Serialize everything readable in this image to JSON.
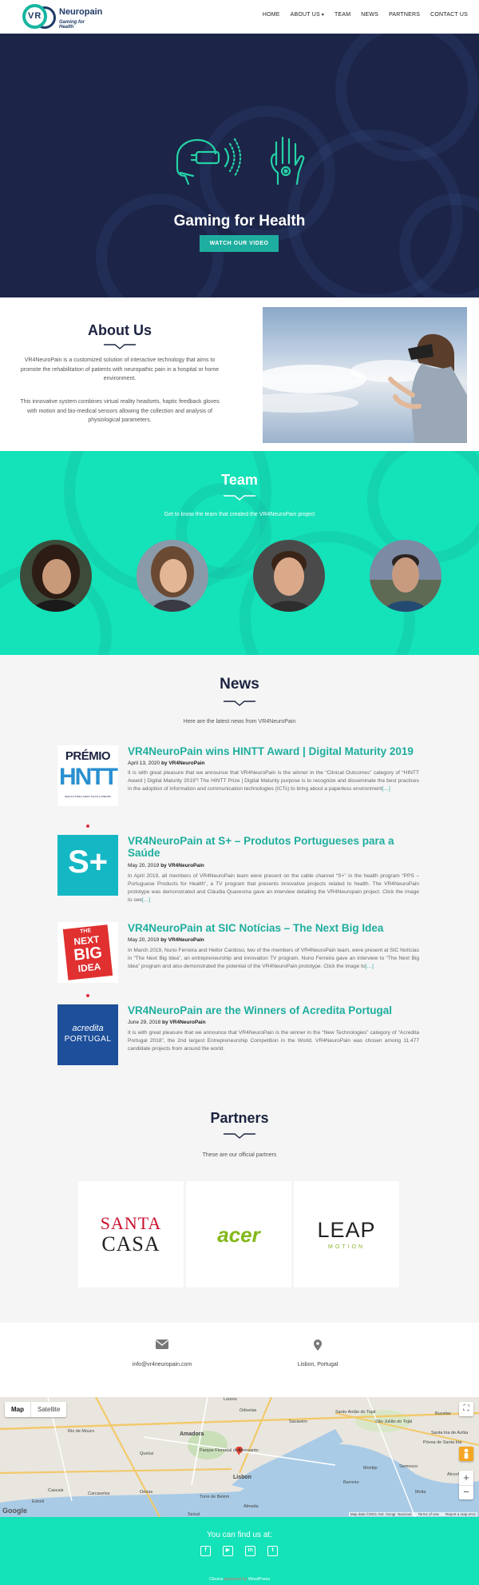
{
  "nav": {
    "logo_text": "VR",
    "brand_name": "Neuropain",
    "brand_tagline": "Gaming for Health",
    "items": [
      {
        "label": "HOME"
      },
      {
        "label": "ABOUT US"
      },
      {
        "label": "TEAM"
      },
      {
        "label": "NEWS"
      },
      {
        "label": "PARTNERS"
      },
      {
        "label": "CONTACT US"
      }
    ]
  },
  "hero": {
    "title": "Gaming for Health",
    "button": "WATCH OUR VIDEO",
    "icons": [
      "vr-headset-icon",
      "haptic-glove-icon"
    ]
  },
  "about": {
    "title": "About Us",
    "p1": "VR4NeuroPain is a customized solution of interactive technology that aims to promote the rehabilitation of patients with neuropathic pain in a hospital or home environment.",
    "p2": "This innovative system combines virtual reality headsets, haptic feedback gloves with motion and bio-medical sensors allowing the collection and analysis of physiological parameters."
  },
  "team": {
    "title": "Team",
    "subtitle": "Get to know the team that created the VR4NeuroPain project"
  },
  "news": {
    "title": "News",
    "subtitle": "Here are the latest news from VR4NeuroPain",
    "items": [
      {
        "title": "VR4NeuroPain wins HINTT Award | Digital Maturity 2019",
        "date": "April 13, 2020",
        "by": "by",
        "author": "VR4NeuroPain",
        "body": "It is with great pleasure that we announce that VR4NeuroPain is the winner in the “Clinical Outcomes” category of “HINTT Award | Digital Maturity 2019”! The HINTT Prize | Digital Maturity purpose is to recognize and disseminate the best practices in the adoption of information and communication technologies (ICTs) to bring about a paperless environment",
        "more": "[…]",
        "thumb_top": "PRÉMIO",
        "thumb_big": "HNTT",
        "thumb_caption": "HEALTH INTELLIGENT TALKS & TRENDS"
      },
      {
        "title": "VR4NeuroPain at S+ – Produtos Portugueses para a Saúde",
        "date": "May 20, 2019",
        "by": "by",
        "author": "VR4NeuroPain",
        "body": "In April 2019, all members of VR4NeuroPain team were present on the cable channel “S+” in the health program “PPS – Portuguese Products for Health”, a TV program that presents innovative projects related to health. The VR4NeuroPain prototype was demonstrated and Cláudia Quaresma gave an interview detailing the VR4Neuropain project. Click the image to see",
        "more": "[…]",
        "thumb_big": "S+"
      },
      {
        "title": "VR4NeuroPain at SIC Notícias – The Next Big Idea",
        "date": "May 20, 2019",
        "by": "by",
        "author": "VR4NeuroPain",
        "body": "In March 2019, Nuno Ferreira and Heitor Cardoso, two of the members of VR4NeuroPain team, were present at SIC Notícias in “The Next Big Idea”, an entrepreneurship and innovation TV program. Nuno Ferreira gave an interview to “The Next Big Idea” program and also demonstrated the potential of the VR4NeuroPain prototype. Click the image to",
        "more": "[…]",
        "thumb_l1": "THE",
        "thumb_l2": "NEXT",
        "thumb_l3": "BIG",
        "thumb_l4": "IDEA"
      },
      {
        "title": "VR4NeuroPain are the Winners of Acredita Portugal",
        "date": "June 29, 2018",
        "by": "by",
        "author": "VR4NeuroPain",
        "body": "It is with great pleasure that we announce that VR4NeuroPain is the winner in the “New Technologies” category of “Acredita Portugal 2018”, the 2nd largest Entrepreneurship Competition in the World. VR4NeuroPain was chosen among 11.477 candidate projects from around the world.",
        "thumb_l1": "acredita",
        "thumb_l2": "PORTUGAL"
      }
    ]
  },
  "partners": {
    "title": "Partners",
    "subtitle": "These are our official partners",
    "logos": [
      {
        "l1": "SANTA",
        "l2": "CASA"
      },
      {
        "l1": "acer"
      },
      {
        "l1": "LEAP",
        "l2": "MOTION"
      }
    ]
  },
  "contact": {
    "email": "info@vr4neuropain.com",
    "location": "Lisbon, Portugal"
  },
  "map": {
    "map_btn": "Map",
    "satellite_btn": "Satellite",
    "google": "Google",
    "attribution": "Map data ©2021 Inst. Geogr. Nacional",
    "terms": "Terms of Use",
    "report": "Report a map error",
    "places": [
      {
        "name": "Amadora"
      },
      {
        "name": "Lisbon"
      },
      {
        "name": "Odivelas"
      },
      {
        "name": "Sacavém"
      },
      {
        "name": "Loures"
      },
      {
        "name": "Almada"
      },
      {
        "name": "Barreiro"
      },
      {
        "name": "Montijo"
      },
      {
        "name": "Seixal"
      },
      {
        "name": "Oeiras"
      },
      {
        "name": "Cascais"
      },
      {
        "name": "Alcochete"
      },
      {
        "name": "Moita"
      },
      {
        "name": "Carcavelos"
      },
      {
        "name": "Estoril"
      },
      {
        "name": "Queluz"
      },
      {
        "name": "Rio de Mouro"
      },
      {
        "name": "Parque Florestal de Monsanto"
      },
      {
        "name": "Torre de Belém"
      },
      {
        "name": "Samouco"
      },
      {
        "name": "Santo Antão do Tojal"
      },
      {
        "name": "São Julião do Tojal"
      },
      {
        "name": "Bucelas"
      },
      {
        "name": "Santa Iria de Azóia"
      },
      {
        "name": "Póvoa de Santa Iria"
      }
    ]
  },
  "footer": {
    "find_us": "You can find us at:",
    "social": [
      "f",
      "▶",
      "in",
      "t"
    ],
    "credit_theme": "Cleona",
    "credit_mid": "powered by",
    "credit_wp": "WordPress"
  }
}
